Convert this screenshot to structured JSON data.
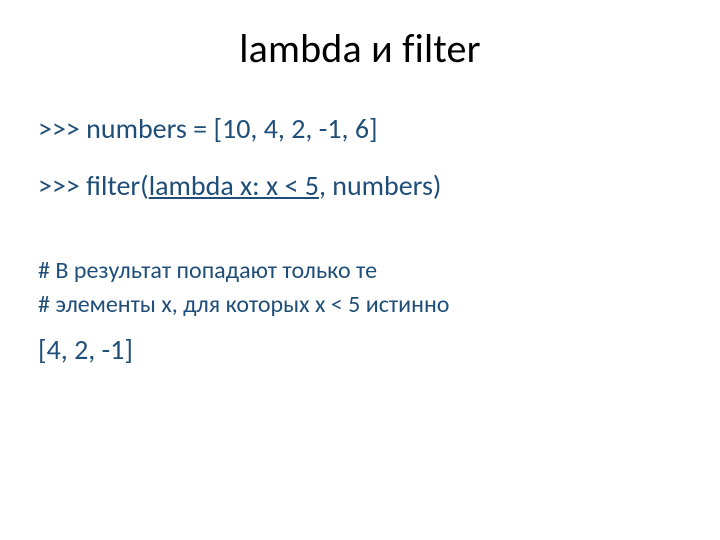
{
  "title": "lambda и filter",
  "line1": {
    "prefix": ">>> numbers = [10, 4, 2, -1, 6]"
  },
  "line2": {
    "prompt_and_call": ">>> filter(",
    "underlined": "lambda x: x < 5",
    "tail": ", numbers)"
  },
  "comment1": "# В результат попадают только те",
  "comment2": "# элементы x, для которых x < 5 истинно",
  "result": "[4, 2, -1]"
}
